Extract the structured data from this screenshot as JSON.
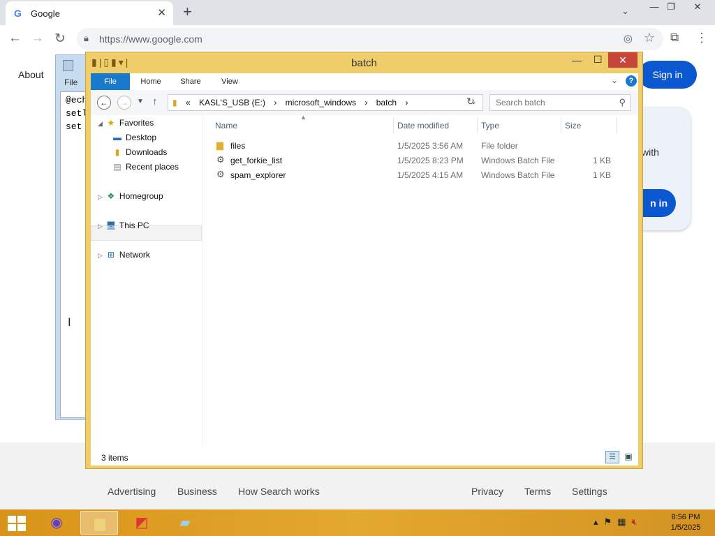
{
  "browser": {
    "tab_title": "Google",
    "tab_favicon": "G",
    "new_tab": "+",
    "url": "https://www.google.com",
    "page": {
      "about": "About",
      "sign_in": "Sign in",
      "card_text_fragment": "with",
      "card_button_fragment": "n in",
      "footer_links": [
        "Advertising",
        "Business",
        "How Search works",
        "Privacy",
        "Terms",
        "Settings"
      ]
    }
  },
  "notepad": {
    "menu_file": "File",
    "lines": [
      "@ech",
      "setl",
      "set "
    ]
  },
  "explorer": {
    "title": "batch",
    "ribbon_tabs": [
      "File",
      "Home",
      "Share",
      "View"
    ],
    "breadcrumb": [
      "«",
      "KASL'S_USB (E:)",
      "›",
      "microsoft_windows",
      "›",
      "batch",
      "›"
    ],
    "search_placeholder": "Search batch",
    "nav_pane": {
      "favorites": "Favorites",
      "favorite_items": [
        "Desktop",
        "Downloads",
        "Recent places"
      ],
      "homegroup": "Homegroup",
      "this_pc": "This PC",
      "network": "Network"
    },
    "columns": [
      "Name",
      "Date modified",
      "Type",
      "Size"
    ],
    "files": [
      {
        "name": "files",
        "date": "1/5/2025 3:56 AM",
        "type": "File folder",
        "size": "",
        "icon": "folder-icon"
      },
      {
        "name": "get_forkie_list",
        "date": "1/5/2025 8:23 PM",
        "type": "Windows Batch File",
        "size": "1 KB",
        "icon": "gear-file-icon"
      },
      {
        "name": "spam_explorer",
        "date": "1/5/2025 4:15 AM",
        "type": "Windows Batch File",
        "size": "1 KB",
        "icon": "gear-file-icon"
      }
    ],
    "status": "3 items"
  },
  "taskbar": {
    "time": "8:56 PM",
    "date": "1/5/2025",
    "accent": "#e3a82f"
  }
}
